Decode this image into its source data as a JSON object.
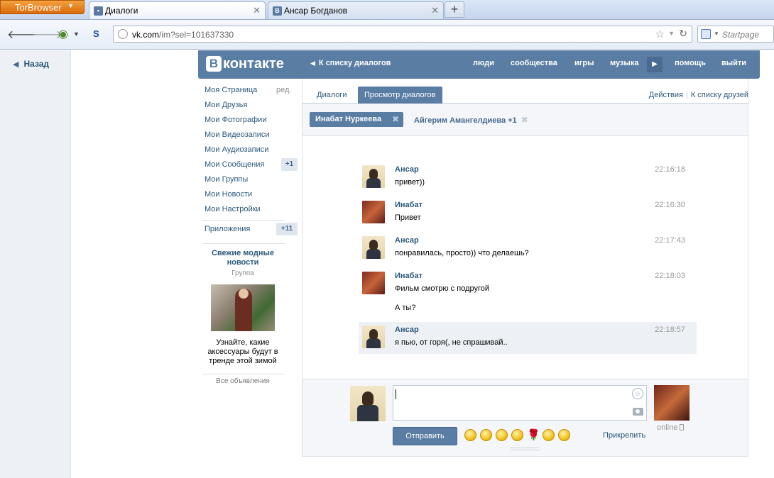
{
  "browser": {
    "tor_button": "TorBrowser",
    "tabs": [
      {
        "title": "Диалоги",
        "favicon": "vk-chat-icon"
      },
      {
        "title": "Ансар Богданов",
        "favicon": "vk-logo-icon",
        "favicon_letter": "B"
      }
    ],
    "new_tab": "+",
    "url_host": "vk.com",
    "url_path": "/im?sel=101637330",
    "search_placeholder": "Startpage"
  },
  "back": {
    "label": "Назад"
  },
  "header": {
    "logo_letter": "В",
    "logo_text": "контакте",
    "to_list": "К списку диалогов",
    "nav": [
      "люди",
      "сообщества",
      "игры",
      "музыка",
      "помощь",
      "выйти"
    ]
  },
  "left_menu": {
    "items": [
      "Моя Страница",
      "Мои Друзья",
      "Мои Фотографии",
      "Мои Видеозаписи",
      "Мои Аудиозаписи",
      "Мои Сообщения",
      "Мои Группы",
      "Мои Новости",
      "Мои Настройки"
    ],
    "edit": "ред.",
    "messages_badge": "+1",
    "apps": "Приложения",
    "apps_badge": "+11"
  },
  "ad": {
    "title": "Свежие модные новости",
    "subtitle": "Группа",
    "text": "Узнайте, какие аксессуары будут в тренде этой зимой",
    "all": "Все объявления"
  },
  "tabs": {
    "dialogs": "Диалоги",
    "view": "Просмотр диалогов",
    "actions": "Действия",
    "sep": "|",
    "friends": "К списку друзей"
  },
  "chips": {
    "active": "Инабат Нуркеева",
    "other": "Айгерим Амангелдиева +1"
  },
  "messages": [
    {
      "name": "Ансар",
      "text": "привет))",
      "time": "22:16:18"
    },
    {
      "name": "Инабат",
      "text": "Привет",
      "time": "22:16:30"
    },
    {
      "name": "Ансар",
      "text": "понравилась, просто)) что делаешь?",
      "time": "22:17:43"
    },
    {
      "name": "Инабат",
      "text": "Фильм смотрю с подругой",
      "text2": "А ты?",
      "time": "22:18:03"
    },
    {
      "name": "Ансар",
      "text": "я пью, от горя(, не спрашивай..",
      "time": "22:18:57"
    }
  ],
  "composer": {
    "input_value": "",
    "send": "Отправить",
    "attach": "Прикрепить",
    "online": "online"
  }
}
